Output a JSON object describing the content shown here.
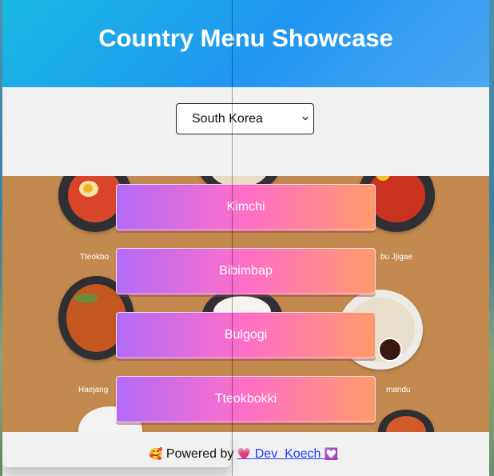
{
  "header": {
    "title": "Country Menu Showcase"
  },
  "controls": {
    "selected_country": "South Korea"
  },
  "dish_labels": {
    "top_left": "Tteokbo",
    "top_right": "bu Jjigae",
    "bottom_left": "Haejang",
    "bottom_right": "mandu"
  },
  "menu": {
    "items": [
      {
        "label": "Kimchi"
      },
      {
        "label": "Bibimbap"
      },
      {
        "label": "Bulgogi"
      },
      {
        "label": "Tteokbokki"
      }
    ]
  },
  "footer": {
    "emoji": "🥰",
    "prefix": "Powered by",
    "heart": "💗",
    "link_text": "Dev  Koech",
    "end_emoji": "💟"
  },
  "colors": {
    "header_start": "#17b8e0",
    "header_end": "#2196f3",
    "button_start": "#b36cf8",
    "button_mid": "#ff6ec7",
    "button_end": "#ff9b6a",
    "food_bg": "#c38a4f"
  }
}
